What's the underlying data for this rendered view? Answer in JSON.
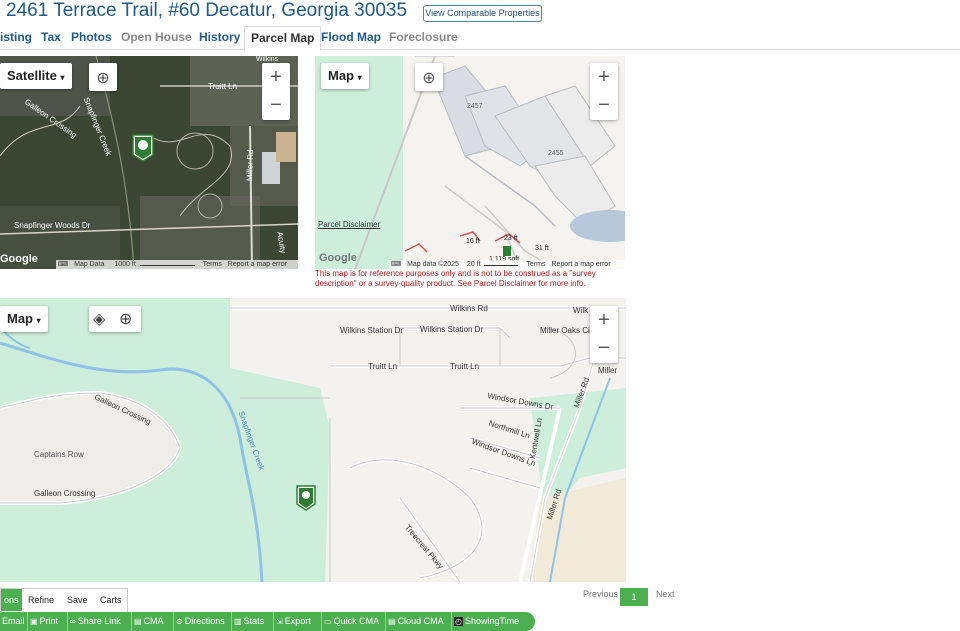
{
  "header": {
    "title": "2461 Terrace Trail, #60 Decatur, Georgia 30035",
    "comparable_button": "View Comparable Properties"
  },
  "tabs": [
    {
      "label": "isting"
    },
    {
      "label": "Tax"
    },
    {
      "label": "Photos"
    },
    {
      "label": "Open House"
    },
    {
      "label": "History"
    },
    {
      "label": "Parcel Map"
    },
    {
      "label": "Flood Map"
    },
    {
      "label": "Foreclosure"
    }
  ],
  "satellite_map": {
    "type_label": "Satellite",
    "labels": [
      "Truitt Ln",
      "Galleon Crossing",
      "Snapfinger Creek",
      "Snapfinger Woods Dr",
      "Miller Rd",
      "Acuity",
      "Wilkins"
    ],
    "attribution": {
      "logo": "Google",
      "keyboard": "⌨",
      "data": "Map Data",
      "scale": "1000 ft",
      "terms": "Terms",
      "report": "Report a map error"
    }
  },
  "parcel_map": {
    "type_label": "Map",
    "parcel_numbers": [
      "2457",
      "2455"
    ],
    "parcel_disclaimer_link": "Parcel Disclaimer",
    "measurements": [
      "16 ft",
      "23 ft",
      "31 ft",
      "1,119 sqft"
    ],
    "attribution": {
      "logo": "Google",
      "keyboard": "⌨",
      "data": "Map data ©2025",
      "scale": "20 ft",
      "terms": "Terms",
      "report": "Report a map error"
    },
    "disclaimer": "This map is for reference purposes only and is not to be construed as a \"survey description\" or a survey-quality product. See Parcel Disclaimer for more info."
  },
  "street_map": {
    "type_label": "Map",
    "labels": [
      "Wilkins Rd",
      "Wilkins Station Dr",
      "Wilkins Station Dr",
      "Miller Oaks Cir",
      "Wilk",
      "Truitt Ln",
      "Truitt Ln",
      "Miller Rd",
      "Miller",
      "Windsor Downs Dr",
      "Northmill Ln",
      "Kentwell Ln",
      "Windsor Downs Ln",
      "Galleon Crossing",
      "Captains Row",
      "Galleon Crossing",
      "Snapfinger Creek",
      "Miller Rd",
      "Treecrest Pkwy"
    ]
  },
  "pagination": {
    "previous": "Previous",
    "current": "1",
    "next": "Next"
  },
  "subtabs": [
    {
      "label": "ons"
    },
    {
      "label": "Refine"
    },
    {
      "label": "Save"
    },
    {
      "label": "Carts"
    }
  ],
  "toolbar": [
    {
      "label": "Email",
      "icon": "email-icon"
    },
    {
      "label": "Print",
      "icon": "print-icon"
    },
    {
      "label": "Share Link",
      "icon": "link-icon"
    },
    {
      "label": "CMA",
      "icon": "document-icon"
    },
    {
      "label": "Directions",
      "icon": "directions-icon"
    },
    {
      "label": "Stats",
      "icon": "stats-icon"
    },
    {
      "label": "Export",
      "icon": "export-icon"
    },
    {
      "label": "Quick CMA",
      "icon": "car-icon"
    },
    {
      "label": "Cloud CMA",
      "icon": "document-icon"
    },
    {
      "label": "ShowingTime",
      "icon": "showingtime-icon"
    }
  ],
  "colors": {
    "accent_green": "#4caf50",
    "link_blue": "#1f5a8a",
    "disclaimer_red": "#b01c1c",
    "map_green": "#c8ecd6",
    "water_blue": "#8fc2e8"
  }
}
